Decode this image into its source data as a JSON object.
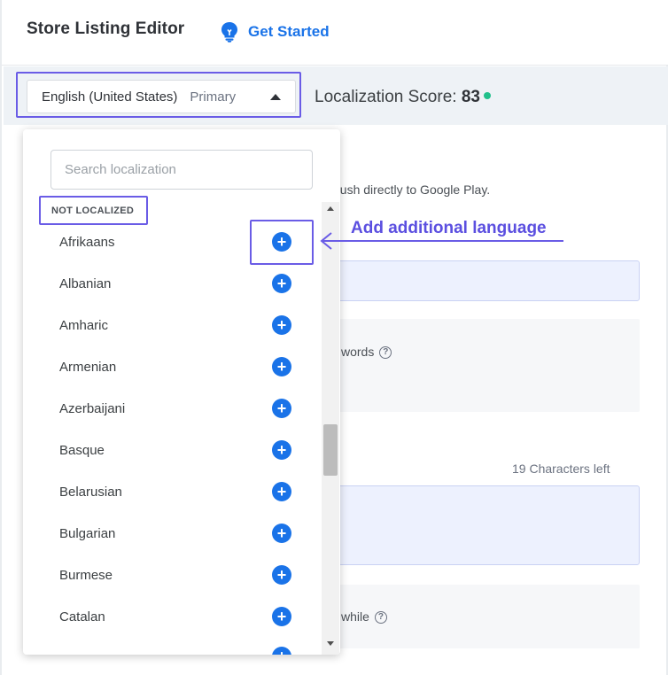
{
  "header": {
    "title": "Store Listing Editor",
    "get_started": "Get Started",
    "icon": "lightbulb-icon"
  },
  "language_bar": {
    "selected_language": "English (United States)",
    "selected_tag": "Primary",
    "score_label": "Localization Score:",
    "score_value": "83",
    "score_status_color": "#21c08b"
  },
  "background": {
    "push_text": "push directly to Google Play.",
    "keywords_text": "words",
    "chars_left": "19 Characters left",
    "while_text": "while"
  },
  "dropdown": {
    "search_placeholder": "Search localization",
    "section_label": "NOT LOCALIZED",
    "items": [
      {
        "label": "Afrikaans"
      },
      {
        "label": "Albanian"
      },
      {
        "label": "Amharic"
      },
      {
        "label": "Armenian"
      },
      {
        "label": "Azerbaijani"
      },
      {
        "label": "Basque"
      },
      {
        "label": "Belarusian"
      },
      {
        "label": "Bulgarian"
      },
      {
        "label": "Burmese"
      },
      {
        "label": "Catalan"
      }
    ],
    "add_icon": "plus-circle-icon"
  },
  "annotation": {
    "text": "Add additional language",
    "color": "#5b4fe0"
  },
  "colors": {
    "accent": "#1a73e8",
    "annotation": "#6a5ce6"
  }
}
